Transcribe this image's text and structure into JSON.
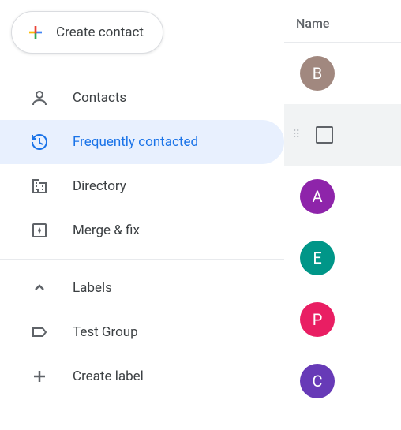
{
  "create_button": {
    "label": "Create contact"
  },
  "nav": {
    "items": [
      {
        "icon": "person",
        "label": "Contacts",
        "active": false
      },
      {
        "icon": "history",
        "label": "Frequently contacted",
        "active": true
      },
      {
        "icon": "domain",
        "label": "Directory",
        "active": false
      },
      {
        "icon": "merge",
        "label": "Merge & fix",
        "active": false
      }
    ],
    "labels_section": {
      "header": "Labels",
      "items": [
        {
          "icon": "label",
          "label": "Test Group"
        }
      ],
      "create": {
        "label": "Create label"
      }
    }
  },
  "main": {
    "header": "Name",
    "contacts": [
      {
        "initial": "B",
        "color": "#a1887f",
        "hovered": false
      },
      {
        "initial": "",
        "color": "",
        "hovered": true
      },
      {
        "initial": "A",
        "color": "#8e24aa",
        "hovered": false
      },
      {
        "initial": "E",
        "color": "#009688",
        "hovered": false
      },
      {
        "initial": "P",
        "color": "#e91e63",
        "hovered": false
      },
      {
        "initial": "C",
        "color": "#673ab7",
        "hovered": false
      }
    ]
  }
}
